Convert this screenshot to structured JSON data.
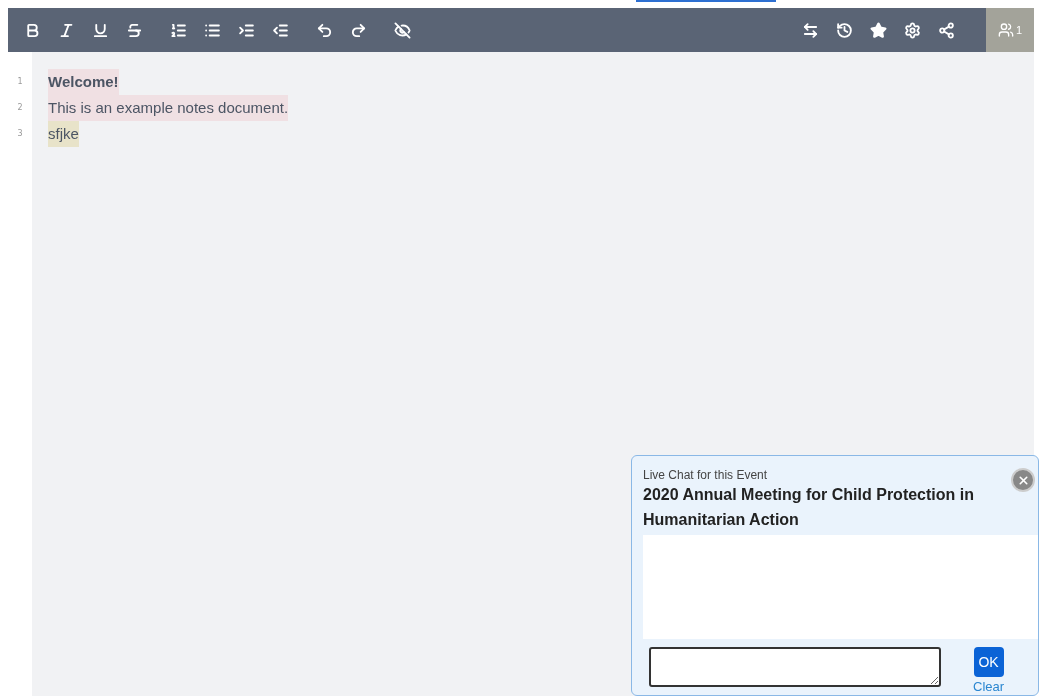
{
  "toolbar": {
    "users_count": "1"
  },
  "lines": [
    {
      "number": "1",
      "text": "Welcome!",
      "bold": true,
      "color": "#f0e0e3"
    },
    {
      "number": "2",
      "text": "This is an example notes document.",
      "bold": false,
      "color": "#f0e0e3"
    },
    {
      "number": "3",
      "text": "sfjke",
      "bold": false,
      "color": "#e8e3c9"
    }
  ],
  "chat": {
    "label": "Live Chat for this Event",
    "title": "2020 Annual Meeting for Child Protection in Humanitarian Action",
    "ok_button": "OK",
    "clear_link": "Clear"
  }
}
